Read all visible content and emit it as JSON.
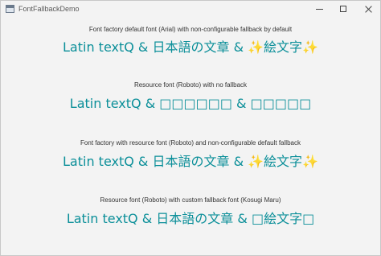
{
  "window": {
    "title": "FontFallbackDemo"
  },
  "sections": [
    {
      "caption": "Font factory default font (Arial) with non-configurable fallback by default",
      "sample": "Latin textQ & 日本語の文章 & ✨絵文字✨"
    },
    {
      "caption": "Resource font (Roboto) with no fallback",
      "sample": "Latin textQ & □□□□□□ & □□□□□"
    },
    {
      "caption": "Font factory with resource font (Roboto) and non-configurable default fallback",
      "sample": "Latin textQ & 日本語の文章 & ✨絵文字✨"
    },
    {
      "caption": "Resource font (Roboto) with custom fallback font (Kosugi Maru)",
      "sample": "Latin textQ & 日本語の文章 & □絵文字□"
    }
  ],
  "colors": {
    "sample_text": "#0b8f99",
    "background": "#f3f3f3"
  },
  "icons": {
    "app": "window-app-icon",
    "minimize": "minimize-icon",
    "maximize": "maximize-icon",
    "close": "close-icon"
  }
}
